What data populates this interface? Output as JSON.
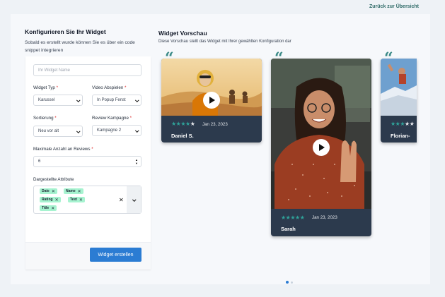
{
  "header": {
    "back_link": "Zurück zur Übersicht"
  },
  "config": {
    "title": "Konfigurieren Sie Ihr Widget",
    "subtitle": "Sobald es erstellt wurde können Sie es über ein code snippet integrieren",
    "widget_name_placeholder": "Ihr Widget Name",
    "widget_type_label": "Widget Typ",
    "widget_type_value": "Karussel",
    "video_play_label": "Video Abspielen",
    "video_play_value": "In Popup Fenst",
    "sort_label": "Sortierung",
    "sort_value": "Neu vor alt",
    "campaign_label": "Review Kampagne",
    "campaign_value": "Kampagne 2",
    "max_reviews_label": "Maximale Anzahl an Reviews",
    "max_reviews_value": "6",
    "attributes_label": "Dargestellte Attribute",
    "attributes": [
      "Date",
      "Name",
      "Rating",
      "Text",
      "Title"
    ],
    "required_mark": "*",
    "create_button": "Widget erstellen"
  },
  "preview": {
    "title": "Widget Vorschau",
    "subtitle": "Diese Vorschau stellt das Widget mit Ihrer gewählten Konfiguration dar",
    "quote_glyph": "“",
    "cards": [
      {
        "name": "Daniel S.",
        "date": "Jan 23, 2023",
        "rating": 4.5
      },
      {
        "name": "Sarah",
        "date": "Jan 23, 2023",
        "rating": 5
      },
      {
        "name": "Florian-",
        "date": "",
        "rating": 3.5
      }
    ],
    "carousel": {
      "pages": 2,
      "active": 0
    }
  },
  "icons": {
    "play": "play-icon",
    "star": "star-icon",
    "quote": "quote-icon",
    "chevron": "chevron-down-icon",
    "remove": "close-icon"
  },
  "colors": {
    "accent": "#2fa39a",
    "primary_button": "#2b7cd3",
    "card_bg": "#2c3a4d",
    "tag_bg": "#a7f3d0"
  }
}
